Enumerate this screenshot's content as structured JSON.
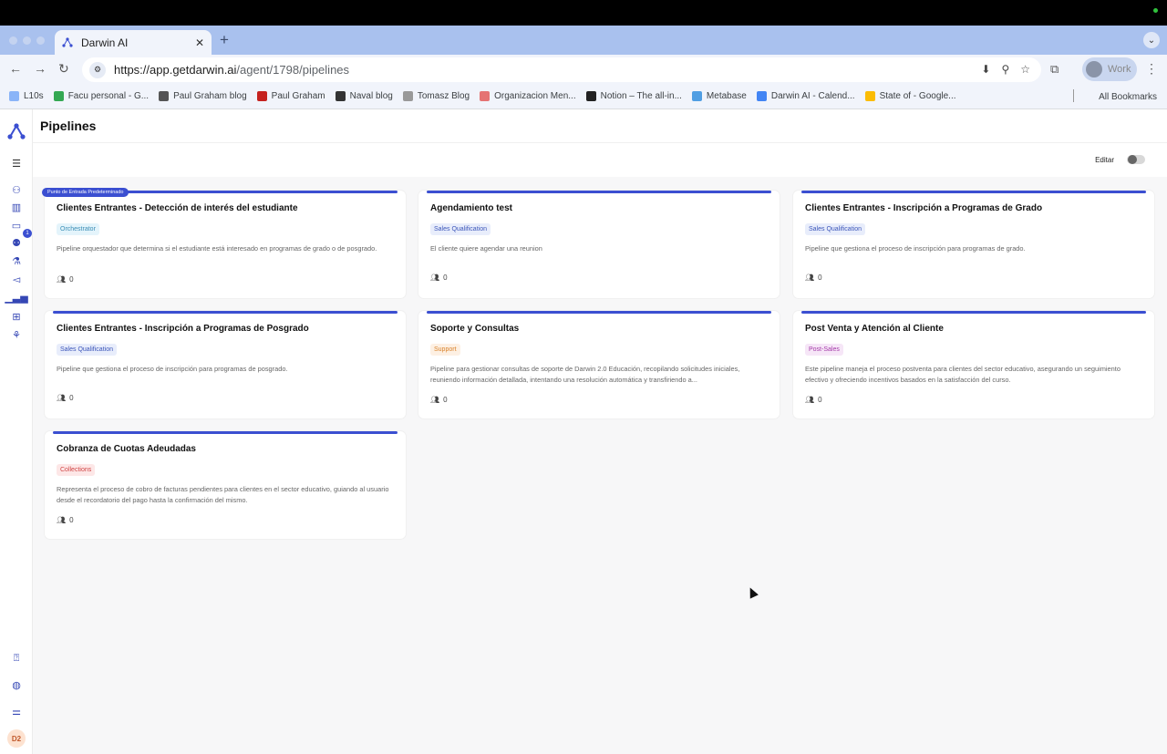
{
  "browser": {
    "tab_title": "Darwin AI",
    "url_host": "https://app.getdarwin.ai",
    "url_path": "/agent/1798/pipelines",
    "profile_label": "Work",
    "bookmarks": [
      {
        "label": "L10s",
        "color": "#8ab4f8"
      },
      {
        "label": "Facu personal - G...",
        "color": "#34a853"
      },
      {
        "label": "Paul Graham blog",
        "color": "#555"
      },
      {
        "label": "Paul Graham",
        "color": "#c5221f"
      },
      {
        "label": "Naval blog",
        "color": "#333"
      },
      {
        "label": "Tomasz Blog",
        "color": "#999"
      },
      {
        "label": "Organizacion Men...",
        "color": "#e57373"
      },
      {
        "label": "Notion – The all-in...",
        "color": "#222"
      },
      {
        "label": "Metabase",
        "color": "#509ee3"
      },
      {
        "label": "Darwin AI - Calend...",
        "color": "#4285f4"
      },
      {
        "label": "State of - Google...",
        "color": "#fbbc04"
      }
    ],
    "all_bookmarks": "All Bookmarks"
  },
  "sidebar": {
    "badge": "1",
    "avatar": "D2"
  },
  "page": {
    "title": "Pipelines",
    "edit_label": "Editar",
    "default_pill": "Punto de Entrada Predeterminado"
  },
  "pipelines": [
    {
      "title": "Clientes Entrantes - Detección de interés del estudiante",
      "tag": "Orchestrator",
      "desc": "Pipeline orquestador que determina si el estudiante está interesado en programas de grado o de posgrado.",
      "users": "0"
    },
    {
      "title": "Agendamiento test",
      "tag": "Sales Qualification",
      "desc": "El cliente quiere agendar una reunion",
      "users": "0"
    },
    {
      "title": "Clientes Entrantes - Inscripción a Programas de Grado",
      "tag": "Sales Qualification",
      "desc": "Pipeline que gestiona el proceso de inscripción para programas de grado.",
      "users": "0"
    },
    {
      "title": "Clientes Entrantes - Inscripción a Programas de Posgrado",
      "tag": "Sales Qualification",
      "desc": "Pipeline que gestiona el proceso de inscripción para programas de posgrado.",
      "users": "0"
    },
    {
      "title": "Soporte y Consultas",
      "tag": "Support",
      "desc": "Pipeline para gestionar consultas de soporte de Darwin 2.0 Educación, recopilando solicitudes iniciales, reuniendo información detallada, intentando una resolución automática y transfiriendo a...",
      "users": "0"
    },
    {
      "title": "Post Venta y Atención al Cliente",
      "tag": "Post-Sales",
      "desc": "Este pipeline maneja el proceso postventa para clientes del sector educativo, asegurando un seguimiento efectivo y ofreciendo incentivos basados en la satisfacción del curso.",
      "users": "0"
    },
    {
      "title": "Cobranza de Cuotas Adeudadas",
      "tag": "Collections",
      "desc": "Representa el proceso de cobro de facturas pendientes para clientes en el sector educativo, guiando al usuario desde el recordatorio del pago hasta la confirmación del mismo.",
      "users": "0"
    }
  ],
  "tag_colors": {
    "Orchestrator": {
      "bg": "#e4f4fb",
      "fg": "#3a8db5"
    },
    "Sales Qualification": {
      "bg": "#e8edfb",
      "fg": "#3b55b9"
    },
    "Support": {
      "bg": "#fdf0e3",
      "fg": "#d9822b"
    },
    "Post-Sales": {
      "bg": "#f6e6f7",
      "fg": "#a43aa8"
    },
    "Collections": {
      "bg": "#fde7e7",
      "fg": "#d04545"
    }
  }
}
